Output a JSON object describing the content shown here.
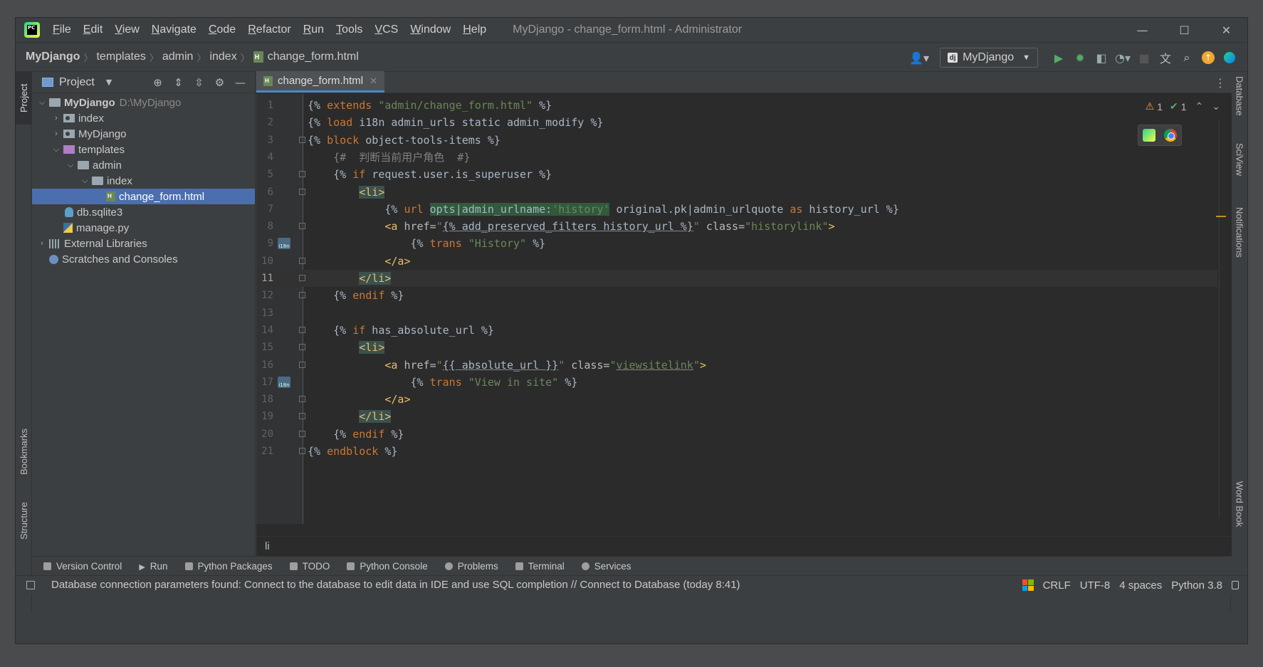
{
  "window": {
    "title": "MyDjango - change_form.html - Administrator",
    "menu": [
      "File",
      "Edit",
      "View",
      "Navigate",
      "Code",
      "Refactor",
      "Run",
      "Tools",
      "VCS",
      "Window",
      "Help"
    ],
    "controls": {
      "minimize": "—",
      "maximize": "☐",
      "close": "✕"
    }
  },
  "navbar": {
    "breadcrumbs": [
      "MyDjango",
      "templates",
      "admin",
      "index",
      "change_form.html"
    ],
    "run_config": "MyDjango"
  },
  "left_strip": {
    "project": "Project",
    "bookmarks": "Bookmarks",
    "structure": "Structure"
  },
  "right_strip": {
    "database": "Database",
    "sciview": "SciView",
    "notifications": "Notifications",
    "wordbook": "Word Book"
  },
  "project_panel": {
    "title": "Project",
    "tree": [
      {
        "label": "MyDjango",
        "hint": "D:\\MyDjango",
        "bold": true
      },
      {
        "label": "index"
      },
      {
        "label": "MyDjango"
      },
      {
        "label": "templates"
      },
      {
        "label": "admin"
      },
      {
        "label": "index"
      },
      {
        "label": "change_form.html",
        "selected": true
      },
      {
        "label": "db.sqlite3"
      },
      {
        "label": "manage.py"
      },
      {
        "label": "External Libraries"
      },
      {
        "label": "Scratches and Consoles"
      }
    ]
  },
  "editor": {
    "tab": "change_form.html",
    "line_numbers": [
      "1",
      "2",
      "3",
      "4",
      "5",
      "6",
      "7",
      "8",
      "9",
      "10",
      "11",
      "12",
      "13",
      "14",
      "15",
      "16",
      "17",
      "18",
      "19",
      "20",
      "21"
    ],
    "current_line": 11,
    "warnings": "1",
    "ok": "1",
    "bottom_breadcrumb": "li",
    "lines": [
      [
        "{% ",
        "extends",
        " ",
        "\"admin/change_form.html\"",
        " %}"
      ],
      [
        "{% ",
        "load",
        " i18n admin_urls static admin_modify %}"
      ],
      [
        "{% ",
        "block",
        " object-tools-items %}"
      ],
      [
        "    {#  判断当前用户角色  #}"
      ],
      [
        "    {% ",
        "if",
        " request.user.is_superuser %}"
      ],
      [
        "        ",
        "<li>"
      ],
      [
        "            {% ",
        "url",
        " ",
        "opts|admin_urlname:",
        "'history'",
        " original.pk|admin_urlquote ",
        "as",
        " history_url %}"
      ],
      [
        "            ",
        "<a ",
        "href=",
        "\"",
        "{% add_preserved_filters history_url %}",
        "\"",
        " class=",
        "\"historylink\"",
        ">"
      ],
      [
        "                {% ",
        "trans",
        " ",
        "\"History\"",
        " %}"
      ],
      [
        "            ",
        "</a>"
      ],
      [
        "        ",
        "</li>"
      ],
      [
        "    {% ",
        "endif",
        " %}"
      ],
      [
        ""
      ],
      [
        "    {% ",
        "if",
        " has_absolute_url %}"
      ],
      [
        "        ",
        "<li>"
      ],
      [
        "            ",
        "<a ",
        "href=",
        "\"",
        "{{ absolute_url }}",
        "\"",
        " class=",
        "\"",
        "viewsitelink",
        "\"",
        ">"
      ],
      [
        "                {% ",
        "trans",
        " ",
        "\"View in site\"",
        " %}"
      ],
      [
        "            ",
        "</a>"
      ],
      [
        "        ",
        "</li>"
      ],
      [
        "    {% ",
        "endif",
        " %}"
      ],
      [
        "{% ",
        "endblock",
        " %}"
      ]
    ]
  },
  "tool_windows": [
    "Version Control",
    "Run",
    "Python Packages",
    "TODO",
    "Python Console",
    "Problems",
    "Terminal",
    "Services"
  ],
  "status": {
    "message": "Database connection parameters found: Connect to the database to edit data in IDE and use SQL completion // Connect to Database (today 8:41)",
    "line_sep": "CRLF",
    "encoding": "UTF-8",
    "indent": "4 spaces",
    "interpreter": "Python 3.8"
  },
  "colors": {
    "keyword": "#cc7832",
    "string": "#6a8759",
    "tag": "#e8bf6a",
    "selection": "#4b6eaf",
    "warning": "#f0a732"
  }
}
